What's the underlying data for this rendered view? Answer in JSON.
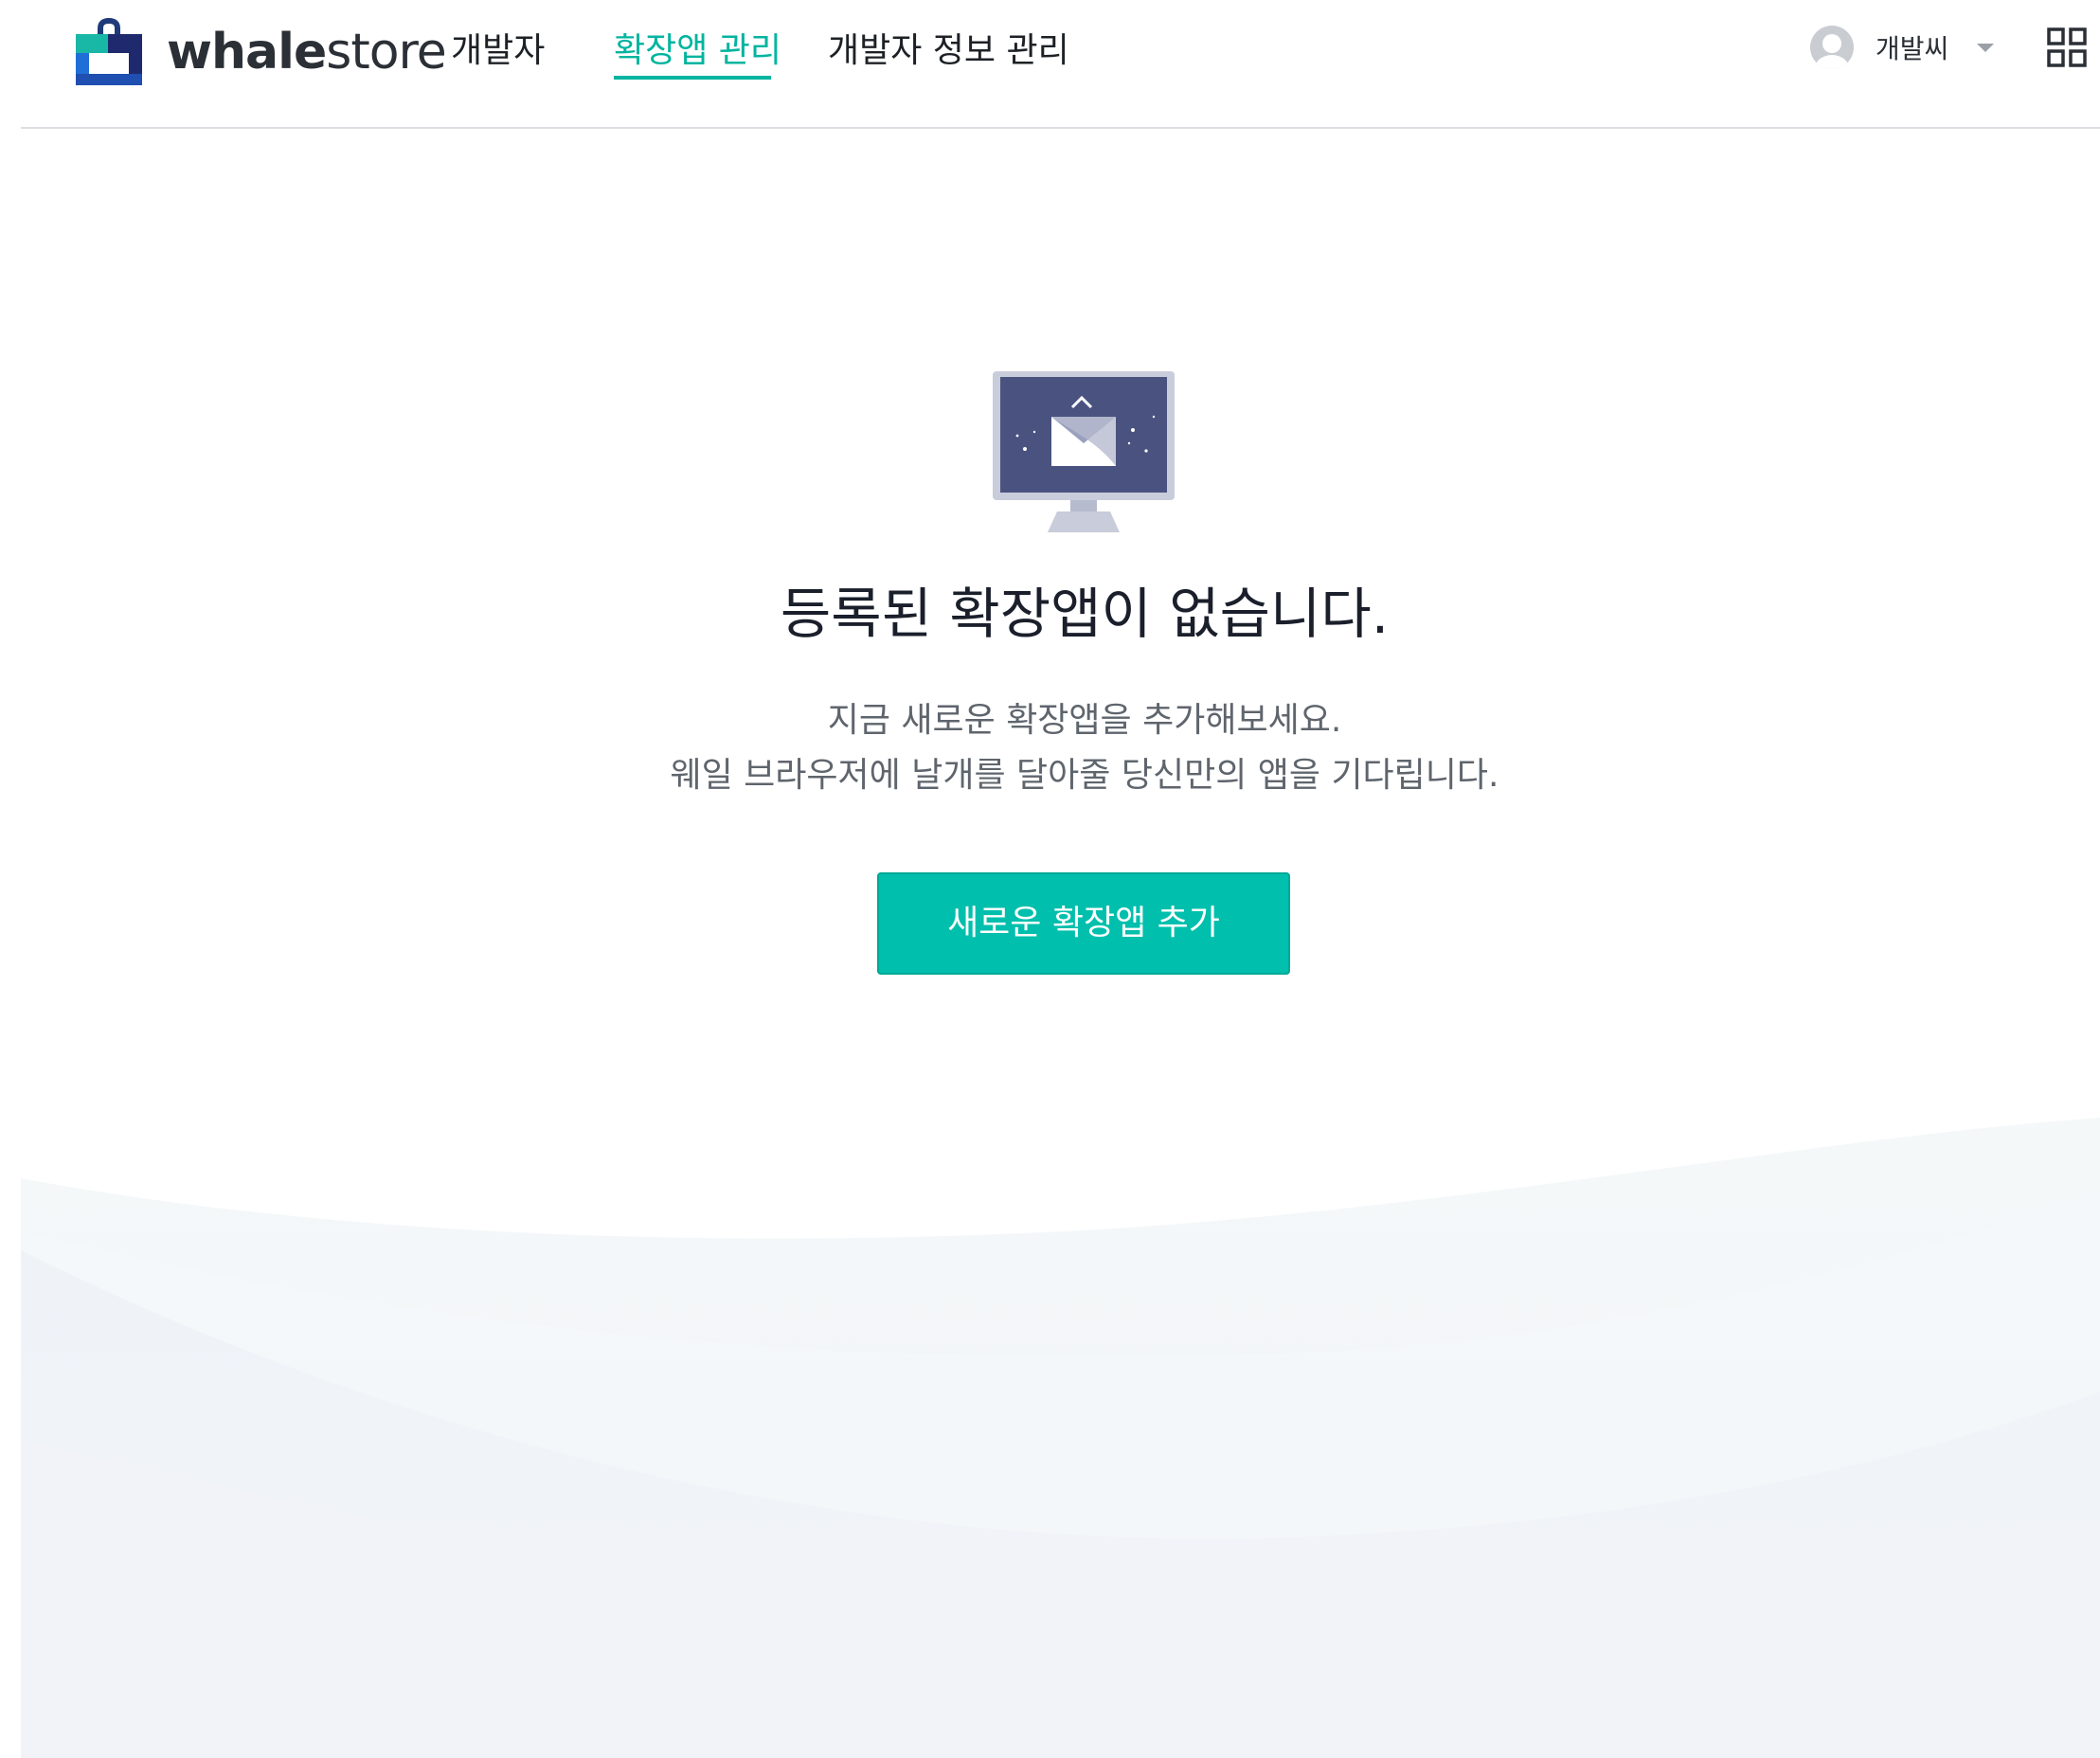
{
  "header": {
    "logo": {
      "bold_part": "whale",
      "light_part": "store"
    },
    "nav": {
      "developer": "개발자",
      "extension_management": "확장앱 관리",
      "developer_info": "개발자 정보 관리"
    },
    "active_nav": "extension_management",
    "user": {
      "name": "개발씨"
    },
    "icons": {
      "logo": "whale-store-bag-icon",
      "avatar": "user-avatar-icon",
      "menu": "chevron-down-icon",
      "apps": "apps-grid-icon"
    }
  },
  "empty_state": {
    "title": "등록된 확장앱이 없습니다.",
    "description_line1": "지금 새로운 확장앱을 추가해보세요.",
    "description_line2": "웨일 브라우저에 날개를 달아줄 당신만의 앱을 기다립니다.",
    "button_label": "새로운 확장앱 추가",
    "illustration": "monitor-with-envelope-icon"
  },
  "colors": {
    "accent": "#00bfac",
    "active_nav": "#00b4a0",
    "title_text": "#1a1f2b",
    "body_text": "#5f656d",
    "monitor_screen": "#4a5380",
    "monitor_frame": "#c9ccda"
  }
}
